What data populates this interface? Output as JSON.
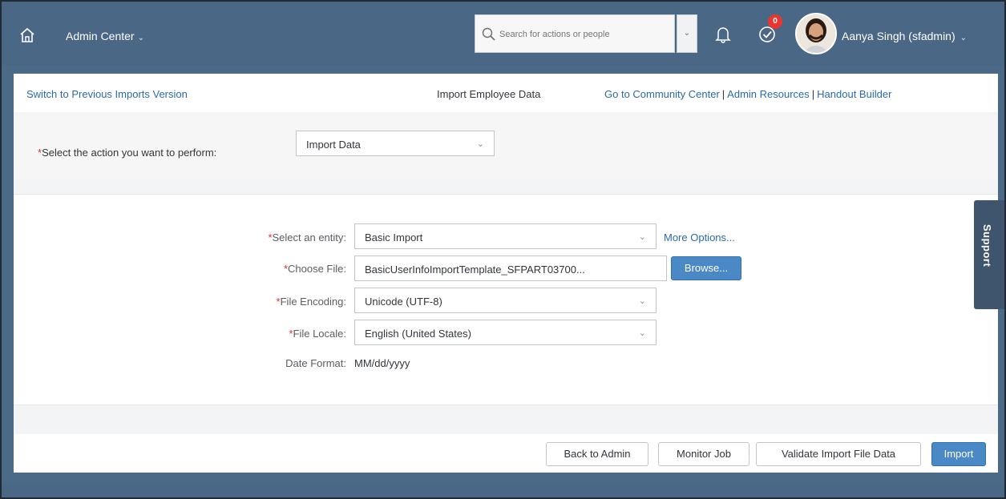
{
  "shell": {
    "title": "Admin Center",
    "search_placeholder": "Search for actions or people",
    "notification_count": "0",
    "user_name": "Aanya Singh (sfadmin)"
  },
  "topbar": {
    "switch_link": "Switch to Previous Imports Version",
    "page_title": "Import Employee Data",
    "links": [
      "Go to Community Center",
      "Admin Resources",
      "Handout Builder"
    ]
  },
  "action": {
    "label": "Select the action you want to perform:",
    "value": "Import Data"
  },
  "form": {
    "entity_label": "Select an entity:",
    "entity_value": "Basic Import",
    "more_options": "More Options...",
    "file_label": "Choose File:",
    "file_value": "BasicUserInfoImportTemplate_SFPART03700...",
    "browse_label": "Browse...",
    "encoding_label": "File Encoding:",
    "encoding_value": "Unicode (UTF-8)",
    "locale_label": "File Locale:",
    "locale_value": "English (United States)",
    "date_label": "Date Format:",
    "date_value": "MM/dd/yyyy"
  },
  "support": {
    "label": "Support"
  },
  "footer": {
    "back": "Back to Admin",
    "monitor": "Monitor Job",
    "validate": "Validate Import File Data",
    "import": "Import"
  }
}
